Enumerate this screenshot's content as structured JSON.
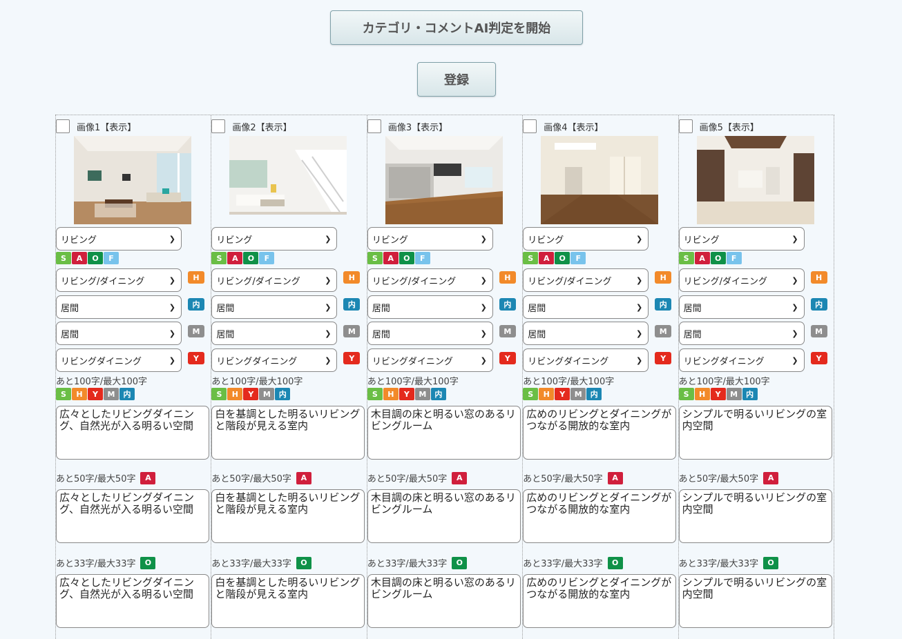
{
  "buttons": {
    "ai_judge": "カテゴリ・コメントAI判定を開始",
    "register": "登録"
  },
  "ui": {
    "sel_category": "リビング",
    "sel_h": "リビング/ダイニング",
    "sel_nai": "居間",
    "sel_m": "居間",
    "sel_y": "リビングダイニング",
    "count100": "あと100字/最大100字",
    "count50": "あと50字/最大50字",
    "count33": "あと33字/最大33字",
    "tag_S": "S",
    "tag_A": "A",
    "tag_O": "O",
    "tag_F": "F",
    "tag_H": "H",
    "tag_Y": "Y",
    "tag_M": "M",
    "tag_NAI": "内"
  },
  "columns": [
    {
      "label": "画像1【表示】",
      "c100": "広々としたリビングダイニング、自然光が入る明るい空間",
      "c50": "広々としたリビングダイニング、自然光が入る明るい空間",
      "c33": "広々としたリビングダイニング、自然光が入る明るい空間"
    },
    {
      "label": "画像2【表示】",
      "c100": "白を基調とした明るいリビングと階段が見える室内",
      "c50": "白を基調とした明るいリビングと階段が見える室内",
      "c33": "白を基調とした明るいリビングと階段が見える室内"
    },
    {
      "label": "画像3【表示】",
      "c100": "木目調の床と明るい窓のあるリビングルーム",
      "c50": "木目調の床と明るい窓のあるリビングルーム",
      "c33": "木目調の床と明るい窓のあるリビングルーム"
    },
    {
      "label": "画像4【表示】",
      "c100": "広めのリビングとダイニングがつながる開放的な室内",
      "c50": "広めのリビングとダイニングがつながる開放的な室内",
      "c33": "広めのリビングとダイニングがつながる開放的な室内"
    },
    {
      "label": "画像5【表示】",
      "c100": "シンプルで明るいリビングの室内空間",
      "c50": "シンプルで明るいリビングの室内空間",
      "c33": "シンプルで明るいリビングの室内空間"
    }
  ]
}
